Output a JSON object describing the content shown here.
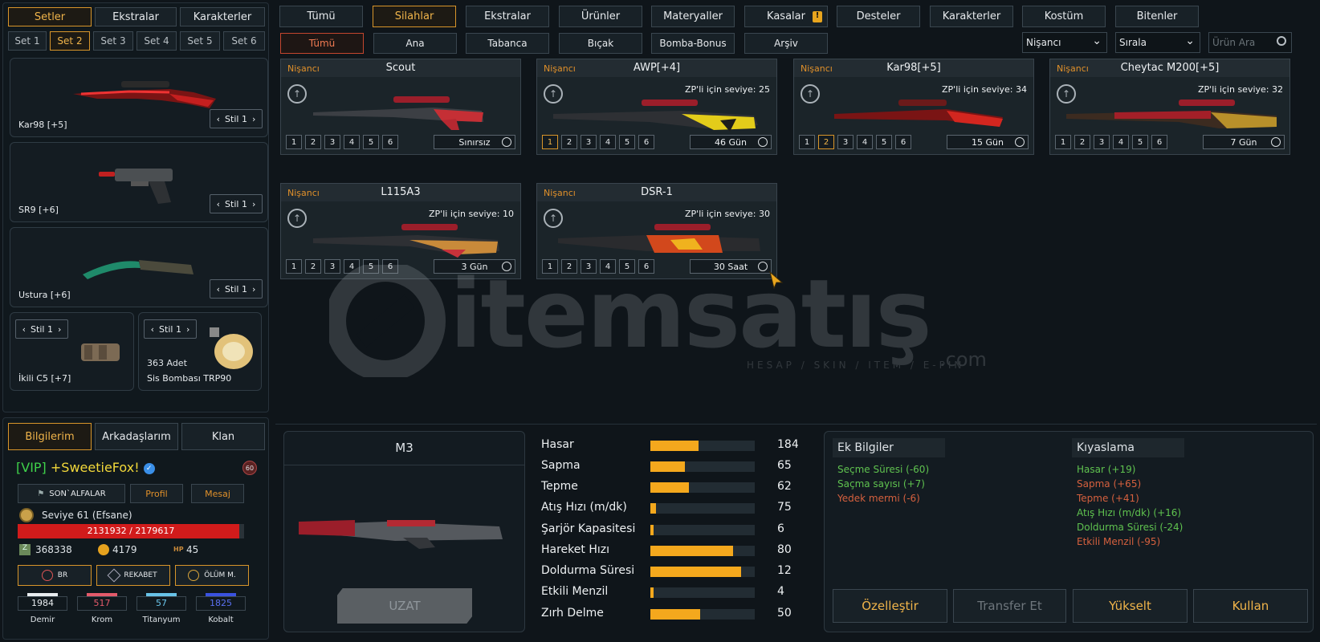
{
  "left": {
    "top_tabs": [
      "Setler",
      "Ekstralar",
      "Karakterler"
    ],
    "set_tabs": [
      "Set 1",
      "Set 2",
      "Set 3",
      "Set 4",
      "Set 5",
      "Set 6"
    ],
    "slots": [
      {
        "label": "Kar98 [+5]",
        "style": "Stil 1"
      },
      {
        "label": "SR9 [+6]",
        "style": "Stil 1"
      },
      {
        "label": "Ustura [+6]",
        "style": "Stil 1"
      }
    ],
    "small_slots": [
      {
        "label": "İkili C5 [+7]",
        "style": "Stil 1",
        "count": ""
      },
      {
        "label": "Sis Bombası TRP90",
        "style": "Stil 1",
        "count": "363 Adet"
      }
    ]
  },
  "profile": {
    "tabs": [
      "Bilgilerim",
      "Arkadaşlarım",
      "Klan"
    ],
    "name": "[VIP] +SweetieFox!",
    "vip_tag": "[VIP]",
    "nick": "+SweetieFox!",
    "clan": "SON`ALFALAR",
    "profile_btn": "Profil",
    "message_btn": "Mesaj",
    "level_text": "Seviye 61 (Efsane)",
    "xp_text": "2131932 / 2179617",
    "xp_fraction": 0.978,
    "zp": "368338",
    "gold": "4179",
    "hp": "45",
    "hp_icon": "HP",
    "rank_badge": "60",
    "modes": [
      "BR",
      "REKABET",
      "ÖLÜM M."
    ],
    "materials": [
      {
        "name": "Demir",
        "value": "1984",
        "color": "#e8ecef"
      },
      {
        "name": "Krom",
        "value": "517",
        "color": "#e35a6a"
      },
      {
        "name": "Titanyum",
        "value": "57",
        "color": "#68c3e8"
      },
      {
        "name": "Kobalt",
        "value": "1825",
        "color": "#3a52e0"
      }
    ]
  },
  "nav": {
    "main_tabs": [
      "Tümü",
      "Silahlar",
      "Ekstralar",
      "Ürünler",
      "Materyaller",
      "Kasalar",
      "Desteler",
      "Karakterler",
      "Kostüm",
      "Bitenler"
    ],
    "alert": "!",
    "sub_tabs": [
      "Tümü",
      "Ana",
      "Tabanca",
      "Bıçak",
      "Bomba-Bonus",
      "Arşiv"
    ],
    "filter_class": "Nişancı",
    "sort": "Sırala",
    "search_placeholder": "Ürün Ara"
  },
  "cards": [
    {
      "cls": "Nişancı",
      "name": "Scout",
      "req": "",
      "lvl_on": 0,
      "duration": "Sınırsız"
    },
    {
      "cls": "Nişancı",
      "name": "AWP[+4]",
      "req": "ZP'li için seviye: 25",
      "lvl_on": 1,
      "duration": "46 Gün"
    },
    {
      "cls": "Nişancı",
      "name": "Kar98[+5]",
      "req": "ZP'li için seviye: 34",
      "lvl_on": 2,
      "duration": "15 Gün"
    },
    {
      "cls": "Nişancı",
      "name": "Cheytac M200[+5]",
      "req": "ZP'li için seviye: 32",
      "lvl_on": 0,
      "duration": "7 Gün"
    },
    {
      "cls": "Nişancı",
      "name": "L115A3",
      "req": "ZP'li için seviye: 10",
      "lvl_on": 0,
      "duration": "3 Gün"
    },
    {
      "cls": "Nişancı",
      "name": "DSR-1",
      "req": "ZP'li için seviye: 30",
      "lvl_on": 0,
      "duration": "30 Saat"
    }
  ],
  "levels": [
    "1",
    "2",
    "3",
    "4",
    "5",
    "6"
  ],
  "detail": {
    "title": "M3",
    "extend_btn": "UZAT",
    "stats": [
      {
        "label": "Hasar",
        "value": "184",
        "fill": 0.46
      },
      {
        "label": "Sapma",
        "value": "65",
        "fill": 0.33
      },
      {
        "label": "Tepme",
        "value": "62",
        "fill": 0.37
      },
      {
        "label": "Atış Hızı (m/dk)",
        "value": "75",
        "fill": 0.05
      },
      {
        "label": "Şarjör Kapasitesi",
        "value": "6",
        "fill": 0.03
      },
      {
        "label": "Hareket Hızı",
        "value": "80",
        "fill": 0.79
      },
      {
        "label": "Doldurma Süresi",
        "value": "12",
        "fill": 0.87
      },
      {
        "label": "Etkili Menzil",
        "value": "4",
        "fill": 0.03
      },
      {
        "label": "Zırh Delme",
        "value": "50",
        "fill": 0.48
      }
    ],
    "extra_title": "Ek Bilgiler",
    "extra": [
      {
        "text": "Seçme Süresi (-60)",
        "kind": "good"
      },
      {
        "text": "Saçma sayısı (+7)",
        "kind": "good"
      },
      {
        "text": "Yedek mermi (-6)",
        "kind": "bad"
      }
    ],
    "compare_title": "Kıyaslama",
    "compare": [
      {
        "text": "Hasar (+19)",
        "kind": "good"
      },
      {
        "text": "Sapma (+65)",
        "kind": "bad"
      },
      {
        "text": "Tepme (+41)",
        "kind": "bad"
      },
      {
        "text": "Atış Hızı (m/dk) (+16)",
        "kind": "good"
      },
      {
        "text": "Doldurma Süresi (-24)",
        "kind": "good"
      },
      {
        "text": "Etkili Menzil (-95)",
        "kind": "bad"
      }
    ],
    "actions": [
      "Özelleştir",
      "Transfer Et",
      "Yükselt",
      "Kullan"
    ]
  },
  "watermark": {
    "brand": "itemsatış",
    "tagline": "HESAP / SKIN / ITEM / E-PIN",
    "suffix": ".com"
  },
  "colors": {
    "accent": "#f0b44a",
    "bar": "#f4a81d",
    "vip": "#3fd14a",
    "nick": "#f2d83a"
  }
}
